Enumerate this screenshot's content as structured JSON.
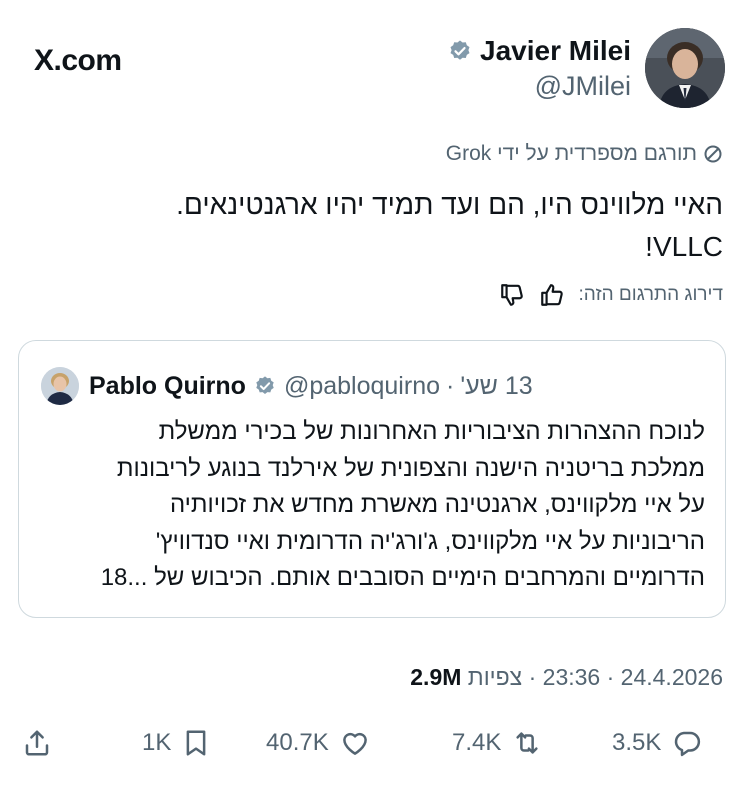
{
  "site": {
    "logo": "X.com"
  },
  "author": {
    "name": "Javier Milei",
    "handle": "@JMilei"
  },
  "translation": {
    "label": "תורגם מספרדית על ידי Grok"
  },
  "tweet": {
    "lines": [
      "האיי מלווינס היו, הם ועד תמיד יהיו ארגנטינאים.",
      "VLLC!"
    ]
  },
  "rating": {
    "label": "דירוג התרגום הזה:"
  },
  "quoted": {
    "time": "13 שע'",
    "handle": "@pabloquirno",
    "name": "Pablo Quirno",
    "lines": [
      "לנוכח ההצהרות הציבוריות האחרונות של בכירי ממשלת",
      "ממלכת בריטניה הישנה והצפונית של אירלנד בנוגע לריבונות",
      "על איי מלקווינס, ארגנטינה מאשרת מחדש את זכויותיה",
      "הריבוניות על איי מלקווינס, ג'ורג'יה הדרומית ואיי סנדוויץ'",
      "הדרומיים והמרחבים הימיים הסובבים אותם. הכיבוש של ...18"
    ]
  },
  "meta": {
    "date": "24.4.2026",
    "time": "23:36",
    "views_count": "2.9M",
    "views_label": "צפיות"
  },
  "actions": {
    "replies": "3.5K",
    "reposts": "7.4K",
    "likes": "40.7K",
    "bookmarks": "1K"
  },
  "colors": {
    "text": "#0f1419",
    "secondary": "#536471",
    "border": "#cfd9de",
    "verified_badge": "#829aab"
  },
  "icons": [
    "verified-badge-icon",
    "translate-icon",
    "thumbs-up-icon",
    "thumbs-down-icon",
    "reply-icon",
    "repost-icon",
    "like-icon",
    "bookmark-icon",
    "share-icon"
  ]
}
